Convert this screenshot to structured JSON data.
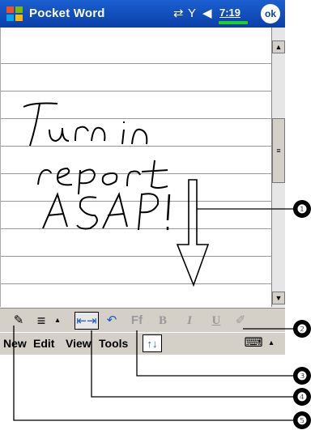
{
  "title_bar": {
    "app_title": "Pocket Word",
    "time": "7:19",
    "ok_label": "ok",
    "icons": [
      "start-flag-icon",
      "connectivity-icon",
      "signal-icon",
      "volume-icon"
    ]
  },
  "document": {
    "handwriting_lines": [
      "Turn in",
      "report",
      "ASAP!"
    ]
  },
  "pen_toolbar": {
    "items": [
      "pen-icon",
      "line-spacing-icon",
      "toolbar-expand-icon",
      "pen-mode-icon",
      "undo-icon",
      "format-icon",
      "B",
      "I",
      "U",
      "highlight-icon"
    ]
  },
  "menu_bar": {
    "menus": [
      "New",
      "Edit",
      "View",
      "Tools"
    ],
    "sip_icon": "keyboard-icon"
  },
  "callouts": [
    "❶",
    "❷",
    "❸",
    "❹",
    "❺"
  ]
}
